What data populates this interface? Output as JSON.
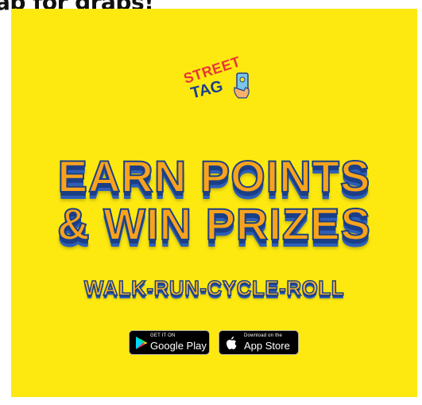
{
  "caption": "ap for grabs!",
  "logo": {
    "line1": "STREET",
    "line2": "TAG",
    "line1_color": "#e8353a",
    "line2_color": "#1d3f8f"
  },
  "headline": {
    "line1": "EARN POINTS",
    "line2": "& WIN PRIZES"
  },
  "tagline": "WALK-RUN-CYCLE-ROLL",
  "badges": {
    "google": {
      "small": "GET IT ON",
      "big": "Google Play",
      "icon": "google-play-icon"
    },
    "apple": {
      "small": "Download on the",
      "big": "App Store",
      "icon": "apple-icon"
    }
  },
  "colors": {
    "background": "#fde910",
    "headline_fill": "#f9a31c",
    "headline_outline": "#1b3f86"
  }
}
